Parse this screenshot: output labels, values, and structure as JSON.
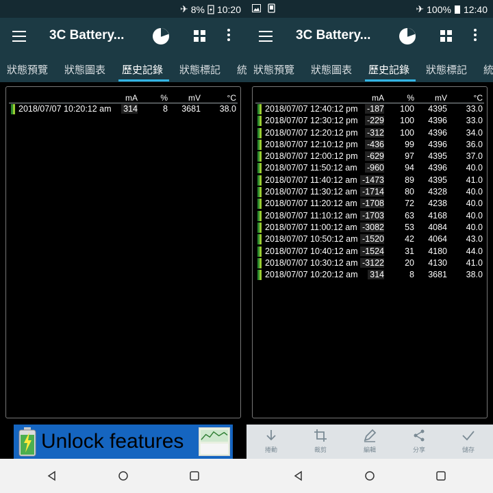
{
  "left": {
    "status": {
      "battery_pct": "8%",
      "time": "10:20"
    },
    "app_title": "3C Battery...",
    "tabs": [
      "狀態預覽",
      "狀態圖表",
      "歷史記錄",
      "狀態標記",
      "統"
    ],
    "columns": [
      "mA",
      "%",
      "mV",
      "°C"
    ],
    "rows": [
      {
        "date": "2018/07/07  10:20:12 am",
        "ma": "314",
        "pct": "8",
        "mv": "3681",
        "temp": "38.0"
      }
    ],
    "ad_text": "Unlock features"
  },
  "right": {
    "status": {
      "battery_pct": "100%",
      "time": "12:40"
    },
    "app_title": "3C Battery...",
    "tabs": [
      "狀態預覽",
      "狀態圖表",
      "歷史記錄",
      "狀態標記",
      "統"
    ],
    "columns": [
      "mA",
      "%",
      "mV",
      "°C"
    ],
    "rows": [
      {
        "date": "2018/07/07  12:40:12 pm",
        "ma": "-187",
        "pct": "100",
        "mv": "4395",
        "temp": "33.0"
      },
      {
        "date": "2018/07/07  12:30:12 pm",
        "ma": "-229",
        "pct": "100",
        "mv": "4396",
        "temp": "33.0"
      },
      {
        "date": "2018/07/07  12:20:12 pm",
        "ma": "-312",
        "pct": "100",
        "mv": "4396",
        "temp": "34.0"
      },
      {
        "date": "2018/07/07  12:10:12 pm",
        "ma": "-436",
        "pct": "99",
        "mv": "4396",
        "temp": "36.0"
      },
      {
        "date": "2018/07/07  12:00:12 pm",
        "ma": "-629",
        "pct": "97",
        "mv": "4395",
        "temp": "37.0"
      },
      {
        "date": "2018/07/07  11:50:12 am",
        "ma": "-960",
        "pct": "94",
        "mv": "4396",
        "temp": "40.0"
      },
      {
        "date": "2018/07/07  11:40:12 am",
        "ma": "-1473",
        "pct": "89",
        "mv": "4395",
        "temp": "41.0"
      },
      {
        "date": "2018/07/07  11:30:12 am",
        "ma": "-1714",
        "pct": "80",
        "mv": "4328",
        "temp": "40.0"
      },
      {
        "date": "2018/07/07  11:20:12 am",
        "ma": "-1708",
        "pct": "72",
        "mv": "4238",
        "temp": "40.0"
      },
      {
        "date": "2018/07/07  11:10:12 am",
        "ma": "-1703",
        "pct": "63",
        "mv": "4168",
        "temp": "40.0"
      },
      {
        "date": "2018/07/07  11:00:12 am",
        "ma": "-3082",
        "pct": "53",
        "mv": "4084",
        "temp": "40.0"
      },
      {
        "date": "2018/07/07  10:50:12 am",
        "ma": "-1520",
        "pct": "42",
        "mv": "4064",
        "temp": "43.0"
      },
      {
        "date": "2018/07/07  10:40:12 am",
        "ma": "-1524",
        "pct": "31",
        "mv": "4180",
        "temp": "44.0"
      },
      {
        "date": "2018/07/07  10:30:12 am",
        "ma": "-3122",
        "pct": "20",
        "mv": "4130",
        "temp": "41.0"
      },
      {
        "date": "2018/07/07  10:20:12 am",
        "ma": "314",
        "pct": "8",
        "mv": "3681",
        "temp": "38.0"
      }
    ],
    "actions": [
      "捲動",
      "裁剪",
      "編輯",
      "分享",
      "儲存"
    ]
  },
  "colors": {
    "appbar": "#1c3a44",
    "statusbar": "#152a32",
    "tab_indicator": "#33b5e5",
    "row_marker": "#2e8b2e"
  }
}
